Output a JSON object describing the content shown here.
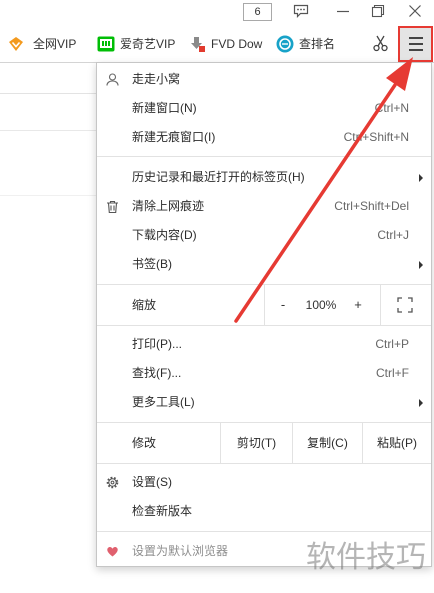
{
  "window": {
    "badge_count": "6",
    "controls": [
      "chat-icon",
      "minimize-icon",
      "restore-icon",
      "close-icon"
    ]
  },
  "bookmarks": [
    {
      "label": "全网VIP",
      "icon": "vip-diamond-icon",
      "color": "#f39a1e"
    },
    {
      "label": "爱奇艺VIP",
      "icon": "iqiyi-icon",
      "color": "#00be06"
    },
    {
      "label": "FVD Dow",
      "icon": "fvd-download-icon",
      "color": "#e23b2e"
    },
    {
      "label": "查排名",
      "icon": "rank-search-icon",
      "color": "#17a2c8"
    }
  ],
  "toolbar": {
    "cut_icon": "scissors-icon",
    "menu_icon": "hamburger-menu-icon",
    "menu_button_bg": "#e4e4e4"
  },
  "menu": {
    "profile": {
      "label": "走走小窝",
      "icon": "user-icon"
    },
    "new_window": {
      "label": "新建窗口(N)",
      "shortcut": "Ctrl+N"
    },
    "new_incognito_window": {
      "label": "新建无痕窗口(I)",
      "shortcut": "Ctrl+Shift+N"
    },
    "history": {
      "label": "历史记录和最近打开的标签页(H)",
      "icon": "submenu-arrow-icon"
    },
    "clear_browsing_data": {
      "label": "清除上网痕迹",
      "shortcut": "Ctrl+Shift+Del",
      "icon": "trash-icon"
    },
    "downloads": {
      "label": "下载内容(D)",
      "shortcut": "Ctrl+J"
    },
    "bookmarks": {
      "label": "书签(B)",
      "icon": "submenu-arrow-icon"
    },
    "zoom": {
      "label": "缩放",
      "minus": "-",
      "value": "100%",
      "plus": "+",
      "fullscreen_icon": "fullscreen-icon"
    },
    "print": {
      "label": "打印(P)...",
      "shortcut": "Ctrl+P"
    },
    "find": {
      "label": "查找(F)...",
      "shortcut": "Ctrl+F"
    },
    "more_tools": {
      "label": "更多工具(L)",
      "icon": "submenu-arrow-icon"
    },
    "edit": {
      "label": "修改",
      "cut": "剪切(T)",
      "copy": "复制(C)",
      "paste": "粘贴(P)"
    },
    "settings": {
      "label": "设置(S)",
      "icon": "gear-icon"
    },
    "check_update": {
      "label": "检查新版本"
    },
    "set_default_browser": {
      "label": "设置为默认浏览器",
      "icon": "heart-icon",
      "color": "#e0606e"
    }
  },
  "annotation": {
    "color": "#e63a33"
  },
  "watermark": "软件技巧"
}
